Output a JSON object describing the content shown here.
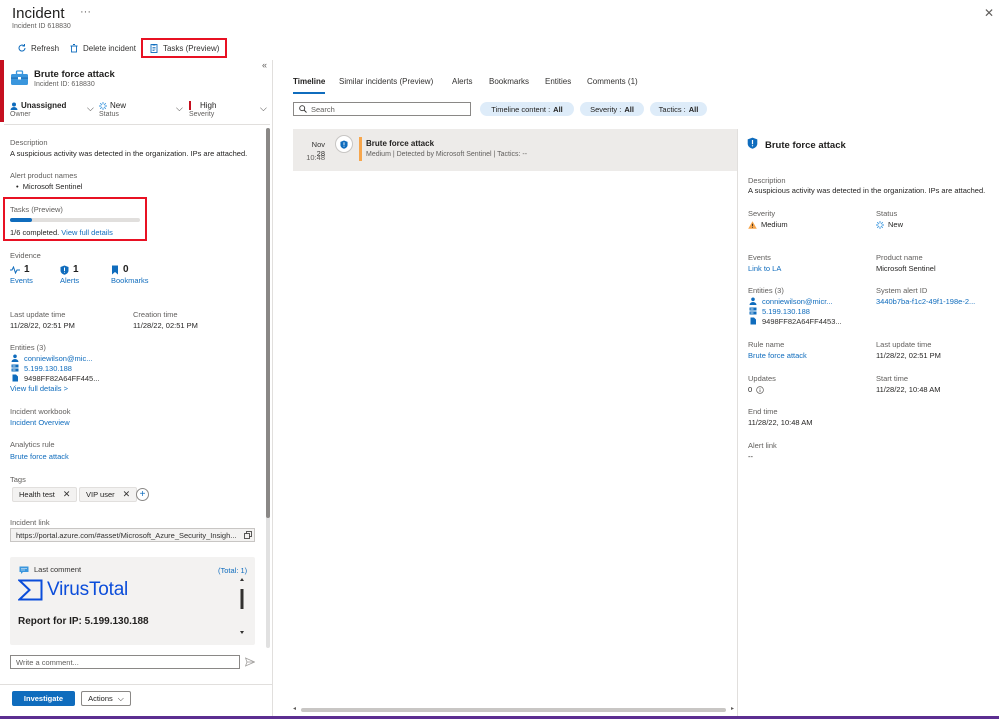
{
  "header": {
    "title": "Incident",
    "more": "···",
    "subtitle": "Incident ID 618830",
    "close": "✕"
  },
  "toolbar": {
    "refresh": "Refresh",
    "delete": "Delete incident",
    "tasks": "Tasks (Preview)"
  },
  "incident": {
    "title": "Brute force attack",
    "id_line": "Incident ID: 618830",
    "owner_value": "Unassigned",
    "owner_label": "Owner",
    "status_value": "New",
    "status_label": "Status",
    "severity_value": "High",
    "severity_label": "Severity",
    "description_label": "Description",
    "description": "A suspicious activity was detected in the organization. IPs are attached.",
    "product_label": "Alert product names",
    "product": "Microsoft Sentinel",
    "tasks_label": "Tasks (Preview)",
    "tasks_progress": 0.1667,
    "tasks_completed": "1/6 completed.",
    "tasks_link": "View full details",
    "evidence_label": "Evidence",
    "evidence": {
      "events_count": "1",
      "events_label": "Events",
      "alerts_count": "1",
      "alerts_label": "Alerts",
      "bookmarks_count": "0",
      "bookmarks_label": "Bookmarks"
    },
    "last_update_label": "Last update time",
    "last_update": "11/28/22, 02:51 PM",
    "creation_label": "Creation time",
    "creation": "11/28/22, 02:51 PM",
    "entities_label": "Entities (3)",
    "entities": [
      "conniewilson@mic...",
      "5.199.130.188",
      "9498FF82A64FF445..."
    ],
    "entities_link": "View full details >",
    "workbook_label": "Incident workbook",
    "workbook": "Incident Overview",
    "analytics_label": "Analytics rule",
    "analytics": "Brute force attack",
    "tags_label": "Tags",
    "tags": [
      "Health test",
      "VIP user"
    ],
    "link_label": "Incident link",
    "link_value": "https://portal.azure.com/#asset/Microsoft_Azure_Security_Insigh...",
    "comment_header": "Last comment",
    "comment_total": "(Total: 1)",
    "comment_brand": "VirusTotal",
    "comment_report": "Report for IP: 5.199.130.188",
    "comment_placeholder": "Write a comment...",
    "investigate": "Investigate",
    "actions": "Actions"
  },
  "tabs": [
    "Timeline",
    "Similar incidents (Preview)",
    "Alerts",
    "Bookmarks",
    "Entities",
    "Comments (1)"
  ],
  "filters": {
    "search_placeholder": "Search",
    "timeline_content_label": "Timeline content :",
    "timeline_content_value": "All",
    "severity_label": "Severity :",
    "severity_value": "All",
    "tactics_label": "Tactics :",
    "tactics_value": "All"
  },
  "timeline_item": {
    "date": "Nov 28",
    "time": "10:48",
    "title": "Brute force attack",
    "subtitle": "Medium | Detected by Microsoft Sentinel | Tactics: --"
  },
  "alert_detail": {
    "title": "Brute force attack",
    "description_label": "Description",
    "description": "A suspicious activity was detected in the organization. IPs are attached.",
    "severity_label": "Severity",
    "severity": "Medium",
    "status_label": "Status",
    "status": "New",
    "events_label": "Events",
    "events_link": "Link to LA",
    "product_label": "Product name",
    "product": "Microsoft Sentinel",
    "entities_label": "Entities (3)",
    "entities": [
      "conniewilson@micr...",
      "5.199.130.188",
      "9498FF82A64FF4453..."
    ],
    "system_alert_label": "System alert ID",
    "system_alert": "3440b7ba-f1c2-49f1-198e-2...",
    "rule_label": "Rule name",
    "rule": "Brute force attack",
    "last_update_label": "Last update time",
    "last_update": "11/28/22, 02:51 PM",
    "updates_label": "Updates",
    "updates": "0",
    "start_label": "Start time",
    "start": "11/28/22, 10:48 AM",
    "end_label": "End time",
    "end": "11/28/22, 10:48 AM",
    "alert_link_label": "Alert link",
    "alert_link": "--"
  },
  "colors": {
    "accent": "#0f6cbd",
    "highlight_box": "#e81123",
    "severity_high": "#c50f1f",
    "severity_medium": "#f7a64c",
    "virustotal": "#0b4dda"
  },
  "icons": [
    "refresh-icon",
    "trash-icon",
    "clipboard-icon",
    "briefcase-icon",
    "person-icon",
    "sparkle-icon",
    "events-icon",
    "shield-icon",
    "bookmark-icon",
    "mail-icon",
    "server-icon",
    "file-icon",
    "copy-icon",
    "comment-icon",
    "send-icon",
    "search-icon",
    "warning-icon",
    "info-icon"
  ]
}
